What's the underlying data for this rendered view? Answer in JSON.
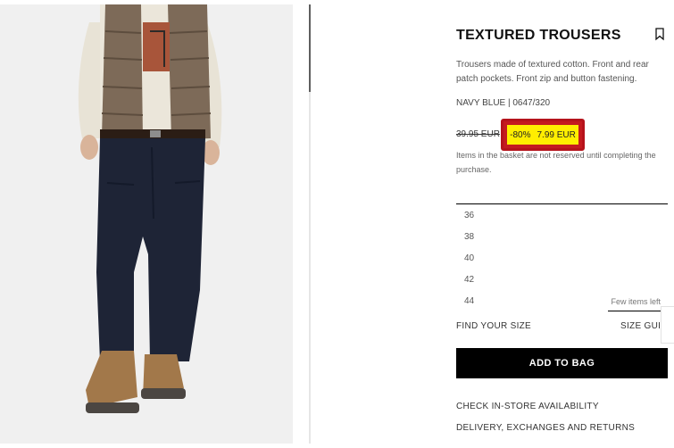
{
  "product": {
    "title": "TEXTURED TROUSERS",
    "description": "Trousers made of textured cotton. Front and rear patch pockets. Front zip and button fastening.",
    "color_ref": "NAVY BLUE | 0647/320",
    "original_price": "39.95 EUR",
    "discount": "-80%",
    "sale_price": "7.99 EUR",
    "basket_note": "Items in the basket are not reserved until completing the purchase."
  },
  "sizes": [
    {
      "label": "36",
      "stock": ""
    },
    {
      "label": "38",
      "stock": ""
    },
    {
      "label": "40",
      "stock": ""
    },
    {
      "label": "42",
      "stock": ""
    },
    {
      "label": "44",
      "stock": "Few items left"
    }
  ],
  "actions": {
    "find_size": "FIND YOUR SIZE",
    "size_guide": "SIZE GUIDE",
    "add_to_bag": "ADD TO BAG",
    "check_store": "CHECK IN-STORE AVAILABILITY",
    "delivery": "DELIVERY, EXCHANGES AND RETURNS"
  },
  "colors": {
    "highlight_border": "#b5131b",
    "highlight_fill": "#ffee00",
    "button_bg": "#000000"
  },
  "icons": {
    "bookmark": "bookmark-icon"
  }
}
